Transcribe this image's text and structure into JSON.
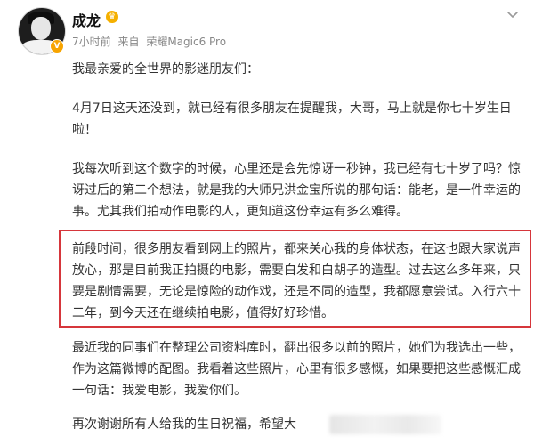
{
  "post": {
    "author": "成龙",
    "time": "7小时前",
    "source_prefix": "来自",
    "source_device": "荣耀Magic6 Pro",
    "paragraphs": [
      "我最亲爱的全世界的影迷朋友们：",
      "4月7日这天还没到，就已经有很多朋友在提醒我，大哥，马上就是你七十岁生日啦！",
      "我每次听到这个数字的时候，心里还是会先惊讶一秒钟，我已经有七十岁了吗？惊讶过后的第二个想法，就是我的大师兄洪金宝所说的那句话：能老，是一件幸运的事。尤其我们拍动作电影的人，更知道这份幸运有多么难得。",
      "前段时间，很多朋友看到网上的照片，都来关心我的身体状态，在这也跟大家说声放心，那是目前我正拍摄的电影，需要白发和白胡子的造型。过去这么多年来，只要是剧情需要，无论是惊险的动作戏，还是不同的造型，我都愿意尝试。入行六十二年，到今天还在继续拍电影，值得好好珍惜。",
      "最近我的同事们在整理公司资料库时，翻出很多以前的照片，她们为我选出一些，作为这篇微博的配图。我看着这些照片，心里有很多感慨，如果要把这些感慨汇成一句话：我爱电影，我爱你们。",
      "再次谢谢所有人给我的生日祝福，希望大"
    ]
  },
  "icons": {
    "verified_badge": "v-badge-icon",
    "crown": "crown-icon",
    "more": "chevron-down-icon"
  },
  "colors": {
    "highlight_border": "#d6363b",
    "meta_text": "#888888",
    "badge": "#f7a400"
  }
}
